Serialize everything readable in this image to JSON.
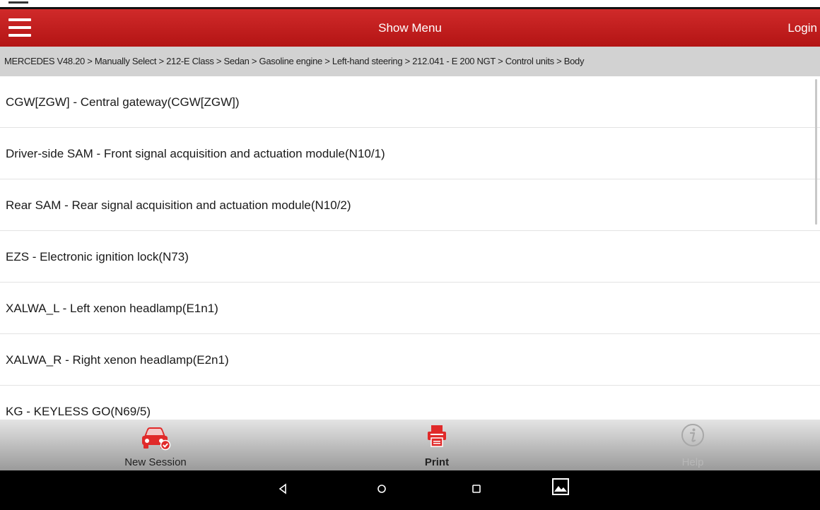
{
  "header": {
    "title": "Show Menu",
    "login_label": "Login"
  },
  "breadcrumb": "MERCEDES V48.20 > Manually Select > 212-E Class > Sedan > Gasoline engine > Left-hand steering > 212.041 - E 200 NGT > Control units > Body",
  "list_items": [
    "CGW[ZGW] - Central gateway(CGW[ZGW])",
    "Driver-side SAM - Front signal acquisition and actuation module(N10/1)",
    "Rear SAM - Rear signal acquisition and actuation module(N10/2)",
    "EZS - Electronic ignition lock(N73)",
    "XALWA_L - Left xenon headlamp(E1n1)",
    "XALWA_R - Right xenon headlamp(E2n1)",
    "KG - KEYLESS GO(N69/5)"
  ],
  "bottom_bar": {
    "new_session_label": "New Session",
    "print_label": "Print",
    "help_label": "Help"
  },
  "icons": {
    "menu": "hamburger-menu-icon",
    "new_session": "car-check-icon",
    "print": "printer-icon",
    "help": "info-icon",
    "back": "back-triangle-icon",
    "home": "home-circle-icon",
    "recents": "recents-square-icon",
    "screenshot": "gallery-icon"
  },
  "colors": {
    "header_red": "#c41f1f",
    "accent_red": "#e02a2a",
    "breadcrumb_bg": "#d2d2d2"
  }
}
